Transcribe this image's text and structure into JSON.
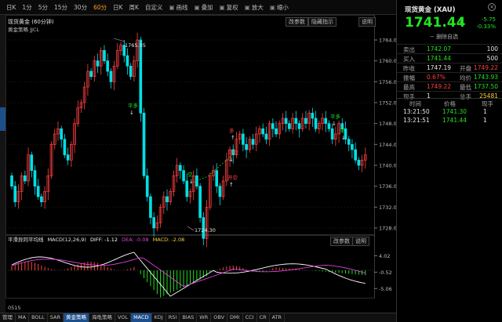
{
  "toolbar": {
    "items": [
      {
        "label": "日K",
        "active": false
      },
      {
        "label": "1分",
        "active": false
      },
      {
        "label": "5分",
        "active": false
      },
      {
        "label": "15分",
        "active": false
      },
      {
        "label": "30分",
        "active": false
      },
      {
        "label": "60分",
        "active": true
      },
      {
        "label": "日K",
        "active": false
      },
      {
        "label": "周K",
        "active": false
      },
      {
        "label": "自定义",
        "active": false
      },
      {
        "label": "画线",
        "active": false,
        "icon": "pencil-icon"
      },
      {
        "label": "叠加",
        "active": false,
        "icon": "overlay-icon"
      },
      {
        "label": "复权",
        "active": false,
        "icon": "restore-icon"
      },
      {
        "label": "放大",
        "active": false,
        "icon": "zoom-in-icon"
      },
      {
        "label": "缩小",
        "active": false,
        "icon": "zoom-out-icon"
      }
    ]
  },
  "main_chart": {
    "title": "现货黄金 (60分钟)",
    "strategy": "黄金策略 JJCL",
    "buttons": [
      "改参数",
      "隐藏指示",
      "说明"
    ],
    "high_label": "1765.05",
    "low_label": "1724.30",
    "signals": [
      {
        "text": "平多",
        "color": "#21e321"
      },
      {
        "text": "空",
        "color": "#21e321"
      },
      {
        "text": "多",
        "color": "#ff4040"
      },
      {
        "text": "开空",
        "color": "#ff4040"
      },
      {
        "text": "平空",
        "color": "#ff4040"
      },
      {
        "text": "平多",
        "color": "#21e321"
      },
      {
        "text": "空",
        "color": "#21e321"
      }
    ]
  },
  "macd_panel": {
    "title": "平滑异同平均线",
    "name": "MACD(12,26,9)",
    "diff_label": "DIFF: -1.12",
    "dea_label": "DEA: -0.08",
    "macd_label": "MACD: -2.08",
    "buttons": [
      "改参数",
      "说明"
    ],
    "axis_labels": [
      "4.02",
      "-0.52",
      "-5.06"
    ]
  },
  "price_axis": {
    "labels": [
      "1764.00",
      "1760.00",
      "1756.00",
      "1752.00",
      "1748.00",
      "1744.00",
      "1740.00",
      "1736.00",
      "1732.00",
      "1728.00"
    ]
  },
  "bottom_tabs": [
    {
      "label": "管理",
      "active": false
    },
    {
      "label": "MA",
      "active": false
    },
    {
      "label": "BOLL",
      "active": false
    },
    {
      "label": "SAR",
      "active": false
    },
    {
      "label": "黄金策略",
      "active": true
    },
    {
      "label": "海龟策略",
      "active": false
    },
    {
      "label": "VOL",
      "active": false
    },
    {
      "label": "MACD",
      "active": true
    },
    {
      "label": "KDJ",
      "active": false
    },
    {
      "label": "RSI",
      "active": false
    },
    {
      "label": "BIAS",
      "active": false
    },
    {
      "label": "WR",
      "active": false
    },
    {
      "label": "OBV",
      "active": false
    },
    {
      "label": "DMI",
      "active": false
    },
    {
      "label": "CCI",
      "active": false
    },
    {
      "label": "CR",
      "active": false
    },
    {
      "label": "ATR",
      "active": false
    }
  ],
  "bottom_left": {
    "code": "0515"
  },
  "quote": {
    "title": "现货黄金 (XAU)",
    "price": "1741.44",
    "change": "-5.75",
    "change_pct": "-0.33%",
    "delete_label": "删除自选",
    "rows": [
      {
        "label": "卖出",
        "value": "1742.07",
        "value_color": "#21e321",
        "label2": "",
        "value2": "100",
        "value2_color": "#e6e6e6"
      },
      {
        "label": "买入",
        "value": "1741.44",
        "value_color": "#21e321",
        "label2": "",
        "value2": "500",
        "value2_color": "#e6e6e6"
      },
      {
        "label": "昨收",
        "value": "1747.19",
        "value_color": "#e6e6e6",
        "label2": "开盘",
        "value2": "1749.22",
        "value2_color": "#ff4040"
      },
      {
        "label": "振幅",
        "value": "0.67%",
        "value_color": "#ff4040",
        "label2": "均价",
        "value2": "1743.93",
        "value2_color": "#21e321"
      },
      {
        "label": "最高",
        "value": "1749.22",
        "value_color": "#ff4040",
        "label2": "最低",
        "value2": "1737.50",
        "value2_color": "#21e321"
      },
      {
        "label": "现手",
        "value": "1",
        "value_color": "#e6e6e6",
        "label2": "总手",
        "value2": "25481",
        "value2_color": "#ffd23a"
      }
    ],
    "trade_headers": [
      "时间",
      "价格",
      "现手"
    ],
    "trades": [
      {
        "time": "13:21:50",
        "price": "1741.30",
        "qty": "1"
      },
      {
        "time": "13:21:51",
        "price": "1741.44",
        "qty": "1"
      }
    ]
  },
  "colors": {
    "up": "#ff4040",
    "down": "#00e0e6",
    "green": "#21e321",
    "dif": "#ffffff",
    "dea": "#e040e0",
    "accent": "#1d4f8c"
  }
}
